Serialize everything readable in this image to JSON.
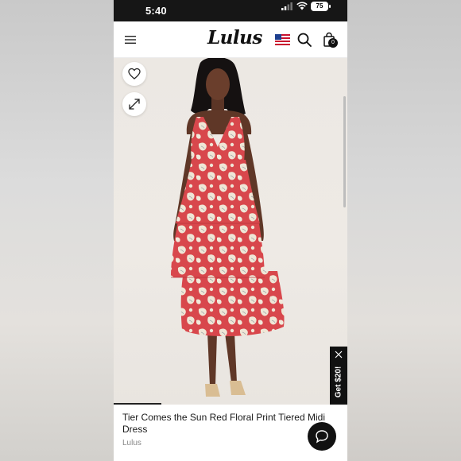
{
  "status_bar": {
    "time": "5:40",
    "battery": "75",
    "icons": [
      "signal-icon",
      "wifi-icon",
      "battery-icon"
    ]
  },
  "nav": {
    "logo": "Lulus",
    "icons": [
      "hamburger-menu-icon",
      "us-flag-icon",
      "search-icon",
      "shopping-bag-icon"
    ],
    "bag_count": "0"
  },
  "product": {
    "title": "Tier Comes the Sun Red Floral Print Tiered Midi Dress",
    "brand": "Lulus",
    "image_icons": [
      "heart-icon",
      "expand-icon"
    ]
  },
  "promo": {
    "label": "Get $20!",
    "close_icon": "close-icon"
  },
  "chat": {
    "icon": "chat-bubble-icon"
  },
  "colors": {
    "status_bar_bg": "#161616",
    "dress_red": "#d8474c",
    "dress_cream": "#efe6d6",
    "promo_bg": "#111111"
  }
}
